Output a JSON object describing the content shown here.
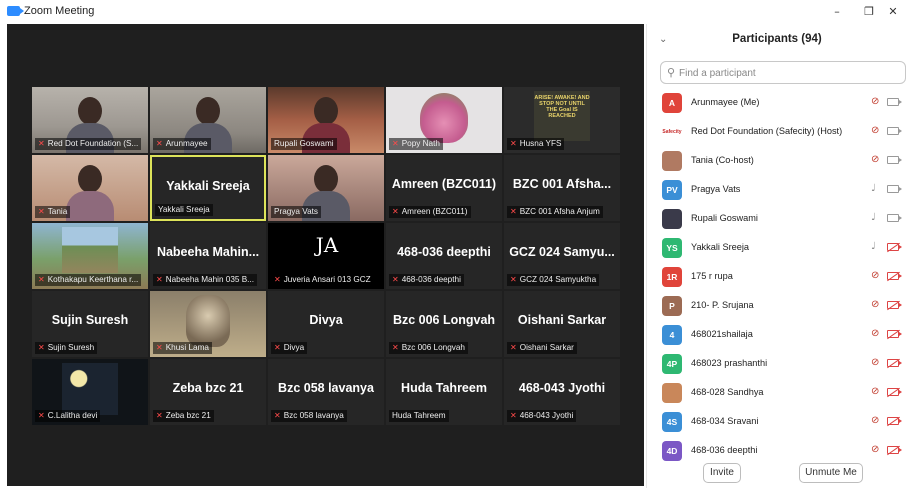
{
  "window": {
    "title": "Zoom Meeting",
    "minimize_glyph": "–",
    "restore_glyph": "❐",
    "close_glyph": "✕"
  },
  "colors": {
    "video_bg": "#1f1f1f",
    "tile_bg": "#262626",
    "active_speaker_border": "#dde35a",
    "muted_red": "#ff4b4b"
  },
  "gallery": [
    {
      "label": "Red Dot Foundation (S...",
      "muted": true,
      "pic": "room"
    },
    {
      "label": "Arunmayee",
      "muted": true,
      "pic": "room2"
    },
    {
      "label": "Rupali Goswami",
      "muted": false,
      "pic": "warm"
    },
    {
      "label": "Popy Nath",
      "muted": true,
      "pic": "flower"
    },
    {
      "label": "Husna YFS",
      "muted": true,
      "pic": "poster",
      "poster_text": "ARISE! AWAKE! AND STOP NOT UNTIL THE Goal IS REACHED"
    },
    {
      "label": "Tania",
      "muted": true,
      "pic": "tania"
    },
    {
      "label": "Yakkali Sreeja",
      "muted": false,
      "big": "Yakkali Sreeja",
      "active": true
    },
    {
      "label": "Pragya Vats",
      "muted": false,
      "pic": "pragya"
    },
    {
      "label": "Amreen (BZC011)",
      "muted": true,
      "big": "Amreen (BZC011)"
    },
    {
      "label": "BZC 001 Afsha Anjum",
      "muted": true,
      "big": "BZC 001 Afsha..."
    },
    {
      "label": "Kothakapu Keerthana r...",
      "muted": true,
      "pic": "wall"
    },
    {
      "label": "Nabeeha Mahin 035 B...",
      "muted": true,
      "big": "Nabeeha Mahin..."
    },
    {
      "label": "Juveria Ansari 013 GCZ",
      "muted": true,
      "pic": "black",
      "logo_text": "JA"
    },
    {
      "label": "468-036 deepthi",
      "muted": true,
      "big": "468-036 deepthi"
    },
    {
      "label": "GCZ 024 Samyuktha",
      "muted": true,
      "big": "GCZ 024 Samyu..."
    },
    {
      "label": "Sujin Suresh",
      "muted": true,
      "big": "Sujin Suresh"
    },
    {
      "label": "Khusi Lama",
      "muted": true,
      "pic": "cat"
    },
    {
      "label": "Divya",
      "muted": true,
      "big": "Divya"
    },
    {
      "label": "Bzc 006 Longvah",
      "muted": true,
      "big": "Bzc 006 Longvah"
    },
    {
      "label": "Oishani Sarkar",
      "muted": true,
      "big": "Oishani Sarkar"
    },
    {
      "label": "C.Lalitha devi",
      "muted": true,
      "pic": "night"
    },
    {
      "label": "Zeba bzc 21",
      "muted": true,
      "big": "Zeba bzc 21"
    },
    {
      "label": "Bzc 058 lavanya",
      "muted": true,
      "big": "Bzc 058 lavanya"
    },
    {
      "label": "Huda Tahreem",
      "muted": false,
      "big": "Huda Tahreem"
    },
    {
      "label": "468-043 Jyothi",
      "muted": true,
      "big": "468-043 Jyothi"
    }
  ],
  "participants_panel": {
    "title": "Participants (94)",
    "collapse_glyph": "⌄",
    "search_placeholder": "Find a participant",
    "search_value": "",
    "list": [
      {
        "name": "Arunmayee (Me)",
        "initials": "A",
        "color": "#e0443a",
        "mic": "muted",
        "video": "on"
      },
      {
        "name": "Red Dot Foundation (Safecity) (Host)",
        "initials": "Safecity",
        "color": "#ffffff",
        "text_color": "#c62828",
        "mic": "muted",
        "video": "on"
      },
      {
        "name": "Tania (Co-host)",
        "initials": "",
        "color": "#b07a62",
        "mic": "muted",
        "video": "on"
      },
      {
        "name": "Pragya Vats",
        "initials": "PV",
        "color": "#3b8fd6",
        "mic": "on",
        "video": "on"
      },
      {
        "name": "Rupali Goswami",
        "initials": "",
        "color": "#3a3a4a",
        "mic": "on",
        "video": "on"
      },
      {
        "name": "Yakkali Sreeja",
        "initials": "YS",
        "color": "#2eb872",
        "mic": "on",
        "video": "off"
      },
      {
        "name": "175 r rupa",
        "initials": "1R",
        "color": "#e0443a",
        "mic": "muted",
        "video": "off"
      },
      {
        "name": "210- P. Srujana",
        "initials": "P",
        "color": "#9c6b54",
        "mic": "muted",
        "video": "off"
      },
      {
        "name": "468021shailaja",
        "initials": "4",
        "color": "#3b8fd6",
        "mic": "muted",
        "video": "off"
      },
      {
        "name": "468023 prashanthi",
        "initials": "4P",
        "color": "#2eb872",
        "mic": "muted",
        "video": "off"
      },
      {
        "name": "468-028 Sandhya",
        "initials": "",
        "color": "#c9875a",
        "mic": "muted",
        "video": "off"
      },
      {
        "name": "468-034 Sravani",
        "initials": "4S",
        "color": "#3b8fd6",
        "mic": "muted",
        "video": "off"
      },
      {
        "name": "468-036 deepthi",
        "initials": "4D",
        "color": "#7b57c5",
        "mic": "muted",
        "video": "off"
      }
    ],
    "invite_label": "Invite",
    "unmute_me_label": "Unmute Me"
  },
  "icons": {
    "muted_mic": "mic-muted-icon",
    "mic": "mic-icon",
    "video": "video-camera-icon",
    "video_off": "video-off-icon",
    "search": "search-icon"
  }
}
